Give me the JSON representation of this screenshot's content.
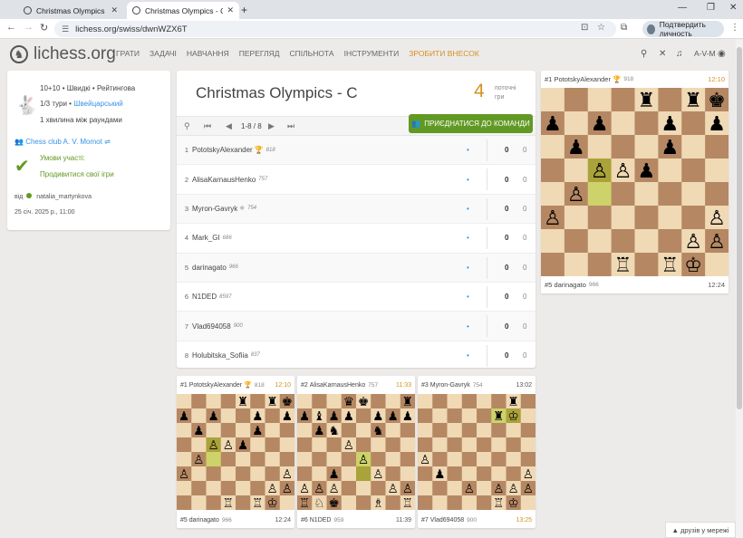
{
  "browser": {
    "tabs": [
      {
        "title": "Christmas Olympics - A by A.V.",
        "active": false
      },
      {
        "title": "Christmas Olympics - C by Ches",
        "active": true
      }
    ],
    "url": "lichess.org/swiss/dwnWZX6T",
    "verify_label": "Подтвердить личность"
  },
  "site": {
    "logo_text": "lichess.org",
    "nav": [
      "ГРАТИ",
      "ЗАДАЧІ",
      "НАВЧАННЯ",
      "ПЕРЕГЛЯД",
      "СПІЛЬНОТА",
      "ІНСТРУМЕНТИ",
      "ЗРОБИТИ ВНЕСОК"
    ],
    "username": "A-V-M"
  },
  "info": {
    "format": "10+10 • Швидкі • Рейтингова",
    "rounds_prefix": "1/3 тури •",
    "rounds_link": "Швейцарський",
    "interval": "1 хвилина між раундами",
    "team": "Chess club A. V. Momot",
    "conditions_label": "Умови участі:",
    "conditions_value": "Продивитися свої ігри",
    "by_label": "від",
    "author": "natalia_martynkova",
    "date": "25 січ. 2025 р., 11:00"
  },
  "tournament": {
    "title": "Christmas Olympics - C",
    "ongoing_count": "4",
    "ongoing_label_1": "поточні",
    "ongoing_label_2": "гри",
    "pager": "1-8 / 8",
    "join_label": "ПРИЄДНАТИСЯ ДО КОМАНДИ",
    "players": [
      {
        "rank": "1",
        "name": "PototskyAlexander",
        "trophy": true,
        "rating": "818",
        "points": "0",
        "tb": "0"
      },
      {
        "rank": "2",
        "name": "AlisaKarnausHenko",
        "trophy": false,
        "rating": "757",
        "points": "0",
        "tb": "0"
      },
      {
        "rank": "3",
        "name": "Myron-Gavryk",
        "trophy": false,
        "rating": "754",
        "points": "0",
        "tb": "0"
      },
      {
        "rank": "4",
        "name": "Mark_GI",
        "trophy": false,
        "rating": "686",
        "points": "0",
        "tb": "0"
      },
      {
        "rank": "5",
        "name": "darinagato",
        "trophy": false,
        "rating": "966",
        "points": "0",
        "tb": "0"
      },
      {
        "rank": "6",
        "name": "N1DED",
        "trophy": false,
        "rating": "8597",
        "points": "0",
        "tb": "0"
      },
      {
        "rank": "7",
        "name": "Vlad694058",
        "trophy": false,
        "rating": "900",
        "points": "0",
        "tb": "0"
      },
      {
        "rank": "8",
        "name": "Holubitska_Sofiia",
        "trophy": false,
        "rating": "837",
        "points": "0",
        "tb": "0"
      }
    ]
  },
  "games": {
    "featured": {
      "top": {
        "rank": "#1",
        "name": "PototskyAlexander",
        "rating": "918",
        "clock": "12:10",
        "active": true
      },
      "bottom": {
        "rank": "#5",
        "name": "darinagato",
        "rating": "966",
        "clock": "12:24",
        "active": false
      }
    },
    "minis": [
      {
        "top": {
          "rank": "#1",
          "name": "PototskyAlexander",
          "rating": "818",
          "clock": "12:10",
          "active": true
        },
        "bottom": {
          "rank": "#5",
          "name": "darinagato",
          "rating": "966",
          "clock": "12:24",
          "active": false
        }
      },
      {
        "top": {
          "rank": "#2",
          "name": "AlisaKarnausHenko",
          "rating": "757",
          "clock": "11:33",
          "active": true
        },
        "bottom": {
          "rank": "#6",
          "name": "N1DED",
          "rating": "959",
          "clock": "11:39",
          "active": false
        }
      },
      {
        "top": {
          "rank": "#3",
          "name": "Myron-Gavryk",
          "rating": "754",
          "clock": "13:02",
          "active": false
        },
        "bottom": {
          "rank": "#7",
          "name": "Vlad694058",
          "rating": "900",
          "clock": "13:25",
          "active": true
        }
      }
    ]
  },
  "footer": {
    "friends_label": "друзів у мережі"
  }
}
